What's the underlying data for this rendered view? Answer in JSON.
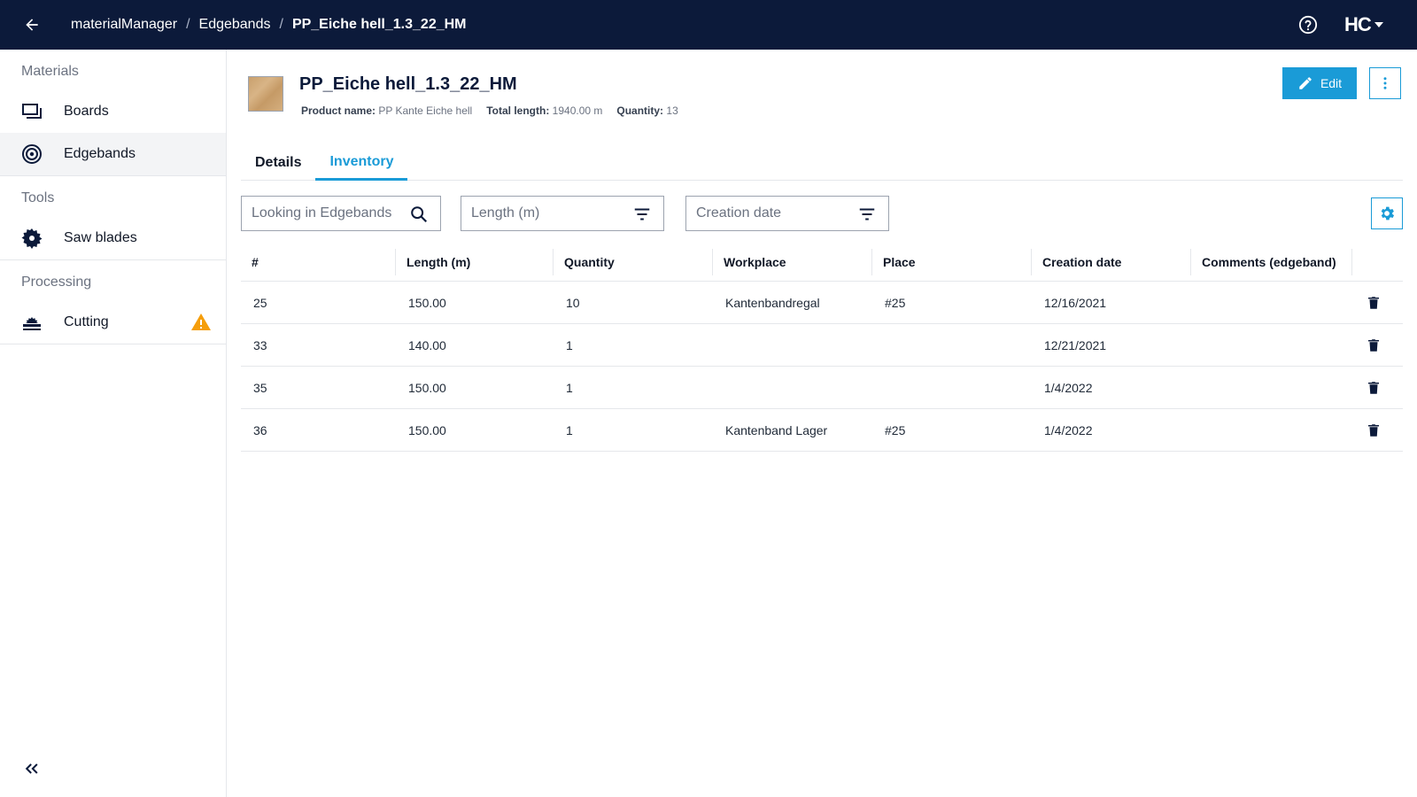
{
  "topbar": {
    "breadcrumb": [
      "materialManager",
      "Edgebands",
      "PP_Eiche hell_1.3_22_HM"
    ],
    "separator": "/",
    "logo_text": "HC"
  },
  "sidebar": {
    "sections": [
      {
        "title": "Materials",
        "items": [
          {
            "label": "Boards",
            "icon": "boards-icon"
          },
          {
            "label": "Edgebands",
            "icon": "edgeband-roll-icon",
            "active": true
          }
        ]
      },
      {
        "title": "Tools",
        "items": [
          {
            "label": "Saw blades",
            "icon": "saw-blade-icon"
          }
        ]
      },
      {
        "title": "Processing",
        "items": [
          {
            "label": "Cutting",
            "icon": "cutting-icon",
            "warning": true
          }
        ]
      }
    ]
  },
  "item": {
    "title": "PP_Eiche hell_1.3_22_HM",
    "product_name_label": "Product name:",
    "product_name": "PP Kante Eiche hell",
    "total_length_label": "Total length:",
    "total_length": "1940.00 m",
    "quantity_label": "Quantity:",
    "quantity": "13"
  },
  "actions": {
    "edit_label": "Edit"
  },
  "tabs": [
    {
      "label": "Details",
      "active": false
    },
    {
      "label": "Inventory",
      "active": true
    }
  ],
  "filters": {
    "search_placeholder": "Looking in Edgebands",
    "length_placeholder": "Length (m)",
    "date_placeholder": "Creation date"
  },
  "table": {
    "columns": [
      "#",
      "Length (m)",
      "Quantity",
      "Workplace",
      "Place",
      "Creation date",
      "Comments (edgeband)"
    ],
    "rows": [
      [
        "25",
        "150.00",
        "10",
        "Kantenbandregal",
        "#25",
        "12/16/2021",
        ""
      ],
      [
        "33",
        "140.00",
        "1",
        "",
        "",
        "12/21/2021",
        ""
      ],
      [
        "35",
        "150.00",
        "1",
        "",
        "",
        "1/4/2022",
        ""
      ],
      [
        "36",
        "150.00",
        "1",
        "Kantenband Lager",
        "#25",
        "1/4/2022",
        ""
      ]
    ]
  },
  "colors": {
    "topbar": "#0c1a3a",
    "accent": "#1a9bd7",
    "warning": "#f59e0b"
  }
}
